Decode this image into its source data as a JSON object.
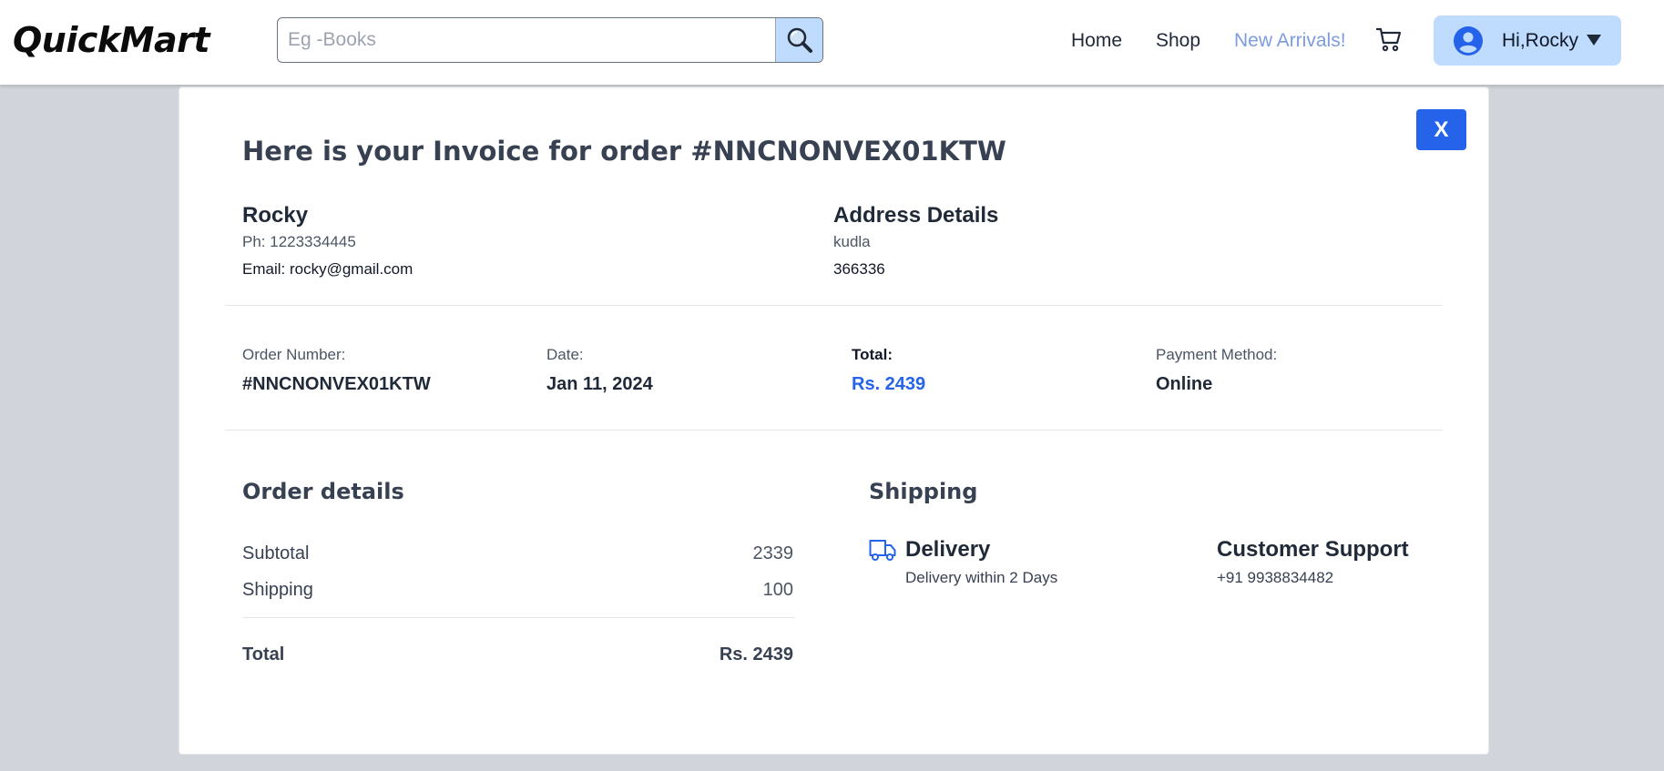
{
  "navbar": {
    "logo": "QuickMart",
    "search_placeholder": "Eg -Books",
    "links": [
      "Home",
      "Shop",
      "New Arrivals!"
    ],
    "user_greeting": "Hi,Rocky"
  },
  "invoice": {
    "close_label": "X",
    "title": "Here is your Invoice for order #NNCNONVEX01KTW",
    "customer": {
      "name": "Rocky",
      "phone": "Ph: 1223334445",
      "email": "Email: rocky@gmail.com"
    },
    "address": {
      "heading": "Address Details",
      "line1": "kudla",
      "line2": "366336"
    },
    "order_summary": {
      "order_number_label": "Order Number:",
      "order_number": "#NNCNONVEX01KTW",
      "date_label": "Date:",
      "date": "Jan 11, 2024",
      "total_label": "Total:",
      "total": "Rs. 2439",
      "payment_label": "Payment Method:",
      "payment": "Online"
    },
    "order_details": {
      "heading": "Order details",
      "subtotal_label": "Subtotal",
      "subtotal": "2339",
      "shipping_label": "Shipping",
      "shipping": "100",
      "total_label": "Total",
      "total": "Rs. 2439"
    },
    "shipping": {
      "heading": "Shipping",
      "delivery_title": "Delivery",
      "delivery_sub": "Delivery within 2 Days",
      "support_title": "Customer Support",
      "support_phone": "+91 9938834482"
    }
  },
  "colors": {
    "accent": "#2563eb",
    "accent_light": "#bfdbfe",
    "nav_highlight": "#7c9cde",
    "backdrop": "#d1d5db"
  }
}
